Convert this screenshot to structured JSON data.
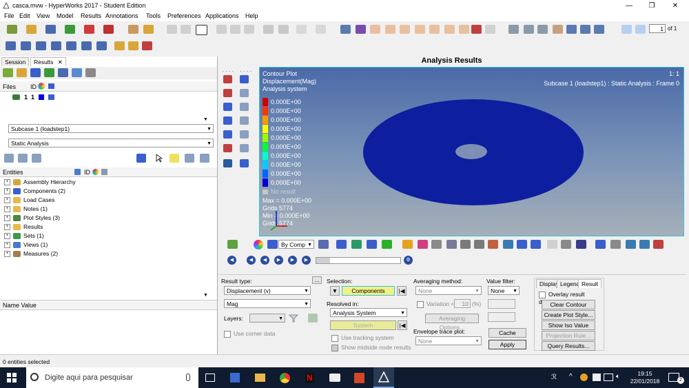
{
  "window": {
    "title": "casca.mvw - HyperWorks 2017 - Student Edition",
    "controls": [
      "—",
      "❐",
      "✕"
    ]
  },
  "menu": [
    "File",
    "Edit",
    "View",
    "Model",
    "Results",
    "Annotations",
    "Tools",
    "Preferences",
    "Applications",
    "Help"
  ],
  "page_nav": {
    "value": "1",
    "of": "of 1"
  },
  "left": {
    "tabs": {
      "session": "Session",
      "results": "Results",
      "results_close": "✕"
    },
    "files_header": {
      "files": "Files",
      "id": "ID"
    },
    "file_row": {
      "id1": "1",
      "id2": "1"
    },
    "subcase": "Subcase 1 (loadstep1)",
    "analysis": "Static Analysis",
    "entities_header": {
      "entities": "Entities",
      "id": "ID"
    },
    "tree": [
      {
        "label": "Assembly Hierarchy",
        "color": "#d9a63a"
      },
      {
        "label": "Components (2)",
        "color": "#3a5fcd"
      },
      {
        "label": "Load Cases",
        "color": "#e8b84a"
      },
      {
        "label": "Notes (1)",
        "color": "#e8b84a"
      },
      {
        "label": "Plot Styles (3)",
        "color": "#4a8a3a"
      },
      {
        "label": "Results",
        "color": "#e8b84a"
      },
      {
        "label": "Sets (1)",
        "color": "#3a9a4a"
      },
      {
        "label": "Views (1)",
        "color": "#4a7ad0"
      },
      {
        "label": "Measures (2)",
        "color": "#a08050"
      }
    ],
    "namevalue_header": "Name Value"
  },
  "status": {
    "text": "0 entities selected"
  },
  "results_header": "Analysis Results",
  "viewport": {
    "title_lines": [
      "Contour Plot",
      "Displacement(Mag)",
      "Analysis system"
    ],
    "top_right_1": "1: 1",
    "top_right_2": "Subcase 1 (loadstep1) : Static Analysis : Frame 0",
    "legend": [
      {
        "label": "0.000E+00",
        "color": "#cc0000"
      },
      {
        "label": "0.000E+00",
        "color": "#ff3300"
      },
      {
        "label": "0.000E+00",
        "color": "#ff9900"
      },
      {
        "label": "0.000E+00",
        "color": "#ffff00"
      },
      {
        "label": "0.000E+00",
        "color": "#99ff00"
      },
      {
        "label": "0.000E+00",
        "color": "#00ff33"
      },
      {
        "label": "0.000E+00",
        "color": "#00ffcc"
      },
      {
        "label": "0.000E+00",
        "color": "#00ccff"
      },
      {
        "label": "0.000E+00",
        "color": "#0066ff"
      },
      {
        "label": "0.000E+00",
        "color": "#0000cc"
      }
    ],
    "no_result": "No result",
    "max": "Max = 0.000E+00",
    "max_grid": "Grids 5774",
    "min": "Min = 0.000E+00",
    "min_grid": "Grids 5774",
    "disk_color": "#0d1f9e"
  },
  "view_toolbar": {
    "bycomp": "By Comp"
  },
  "result_panel": {
    "result_type_label": "Result type:",
    "result_type_btn": "...",
    "result_type": "Displacement (v)",
    "component": "Mag",
    "layers_label": "Layers:",
    "use_corner_data": "Use corner data",
    "selection_label": "Selection:",
    "components_btn": "Components",
    "resolved_in_label": "Resolved in:",
    "resolved_in": "Analysis System",
    "system_btn": "System",
    "use_tracking": "Use tracking system",
    "show_midside": "Show midside node results",
    "averaging_label": "Averaging method:",
    "averaging": "None",
    "variation": "Variation <",
    "variation_val": "10",
    "variation_pct": "(%)",
    "averaging_options": "Averaging Options...",
    "envelope_label": "Envelope trace plot:",
    "envelope": "None",
    "value_filter_label": "Value filter:",
    "value_filter": "None",
    "cache_btn": "Cache",
    "apply_btn": "Apply",
    "tabs": [
      "Display",
      "Legend",
      "Result"
    ],
    "overlay": "Overlay result display",
    "clear_contour": "Clear Contour",
    "create_plot_style": "Create Plot Style...",
    "show_iso": "Show Iso Value",
    "projection_rule": "Projection Rule...",
    "query_results": "Query Results..."
  },
  "taskbar": {
    "search": "Digite aqui para pesquisar",
    "time": "19:15",
    "date": "22/01/2018",
    "notif_count": "2"
  }
}
